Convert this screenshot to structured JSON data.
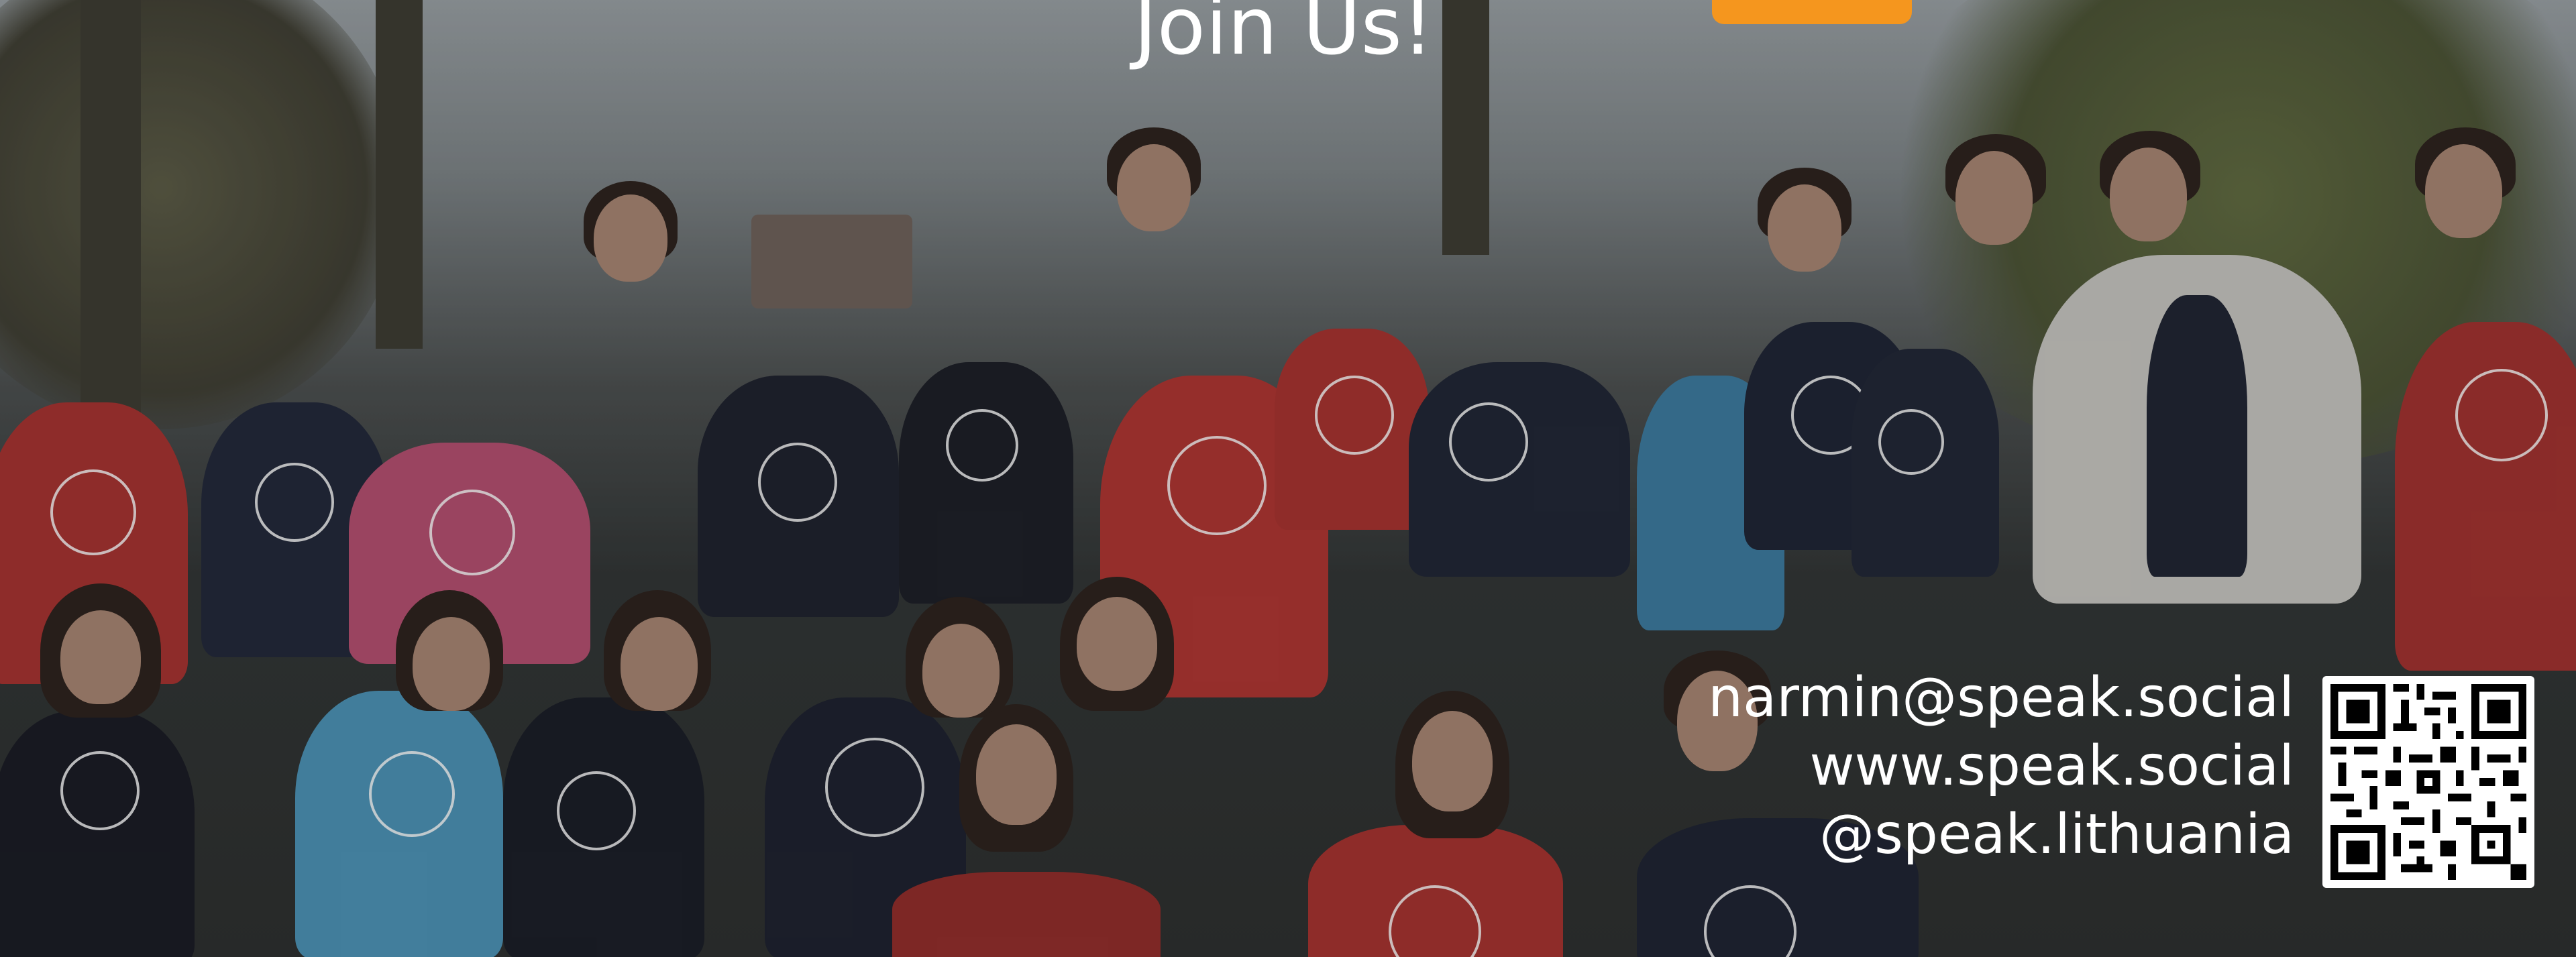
{
  "banner": {
    "title": "Join Us!",
    "accent_color": "#f5961e"
  },
  "contact": {
    "email": "narmin@speak.social",
    "website": "www.speak.social",
    "handle": "@speak.lithuania"
  },
  "qr_code": {
    "icon": "qr-code-icon"
  }
}
